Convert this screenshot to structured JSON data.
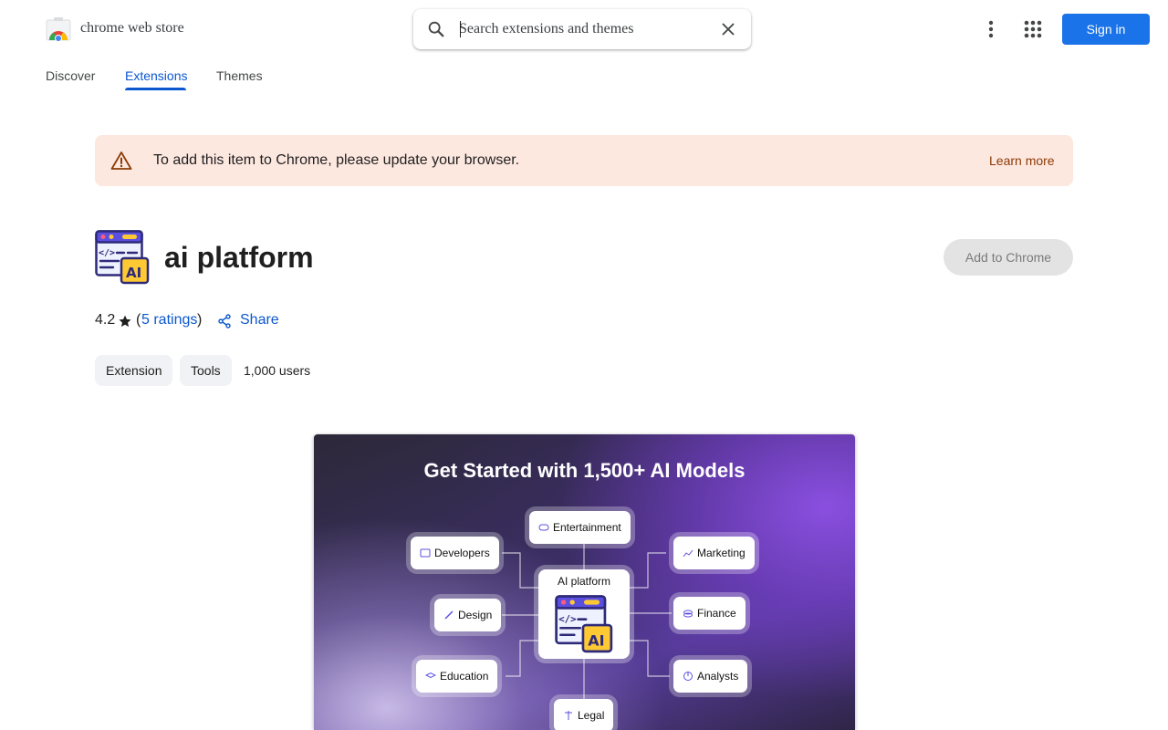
{
  "header": {
    "brand": "chrome web store",
    "search_placeholder": "Search extensions and themes",
    "signin_label": "Sign in"
  },
  "tabs": [
    {
      "label": "Discover",
      "active": false
    },
    {
      "label": "Extensions",
      "active": true
    },
    {
      "label": "Themes",
      "active": false
    }
  ],
  "banner": {
    "message": "To add this item to Chrome, please update your browser.",
    "link": "Learn more"
  },
  "item": {
    "title": "ai platform",
    "add_button": "Add to Chrome",
    "rating": "4.2",
    "ratings_open": "(",
    "ratings_link": "5 ratings",
    "ratings_close": ")",
    "share": "Share",
    "chips": [
      "Extension",
      "Tools"
    ],
    "users": "1,000 users"
  },
  "screenshot": {
    "title": "Get Started with 1,500+ AI Models",
    "center": "AI platform",
    "center_badge": "AI",
    "nodes": {
      "entertainment": "Entertainment",
      "developers": "Developers",
      "marketing": "Marketing",
      "design": "Design",
      "finance": "Finance",
      "education": "Education",
      "analysts": "Analysts",
      "legal": "Legal"
    }
  },
  "colors": {
    "accent": "#0b57d0",
    "signin_bg": "#1a73e8",
    "banner_bg": "#fde8e0",
    "banner_link": "#8c3a05"
  }
}
